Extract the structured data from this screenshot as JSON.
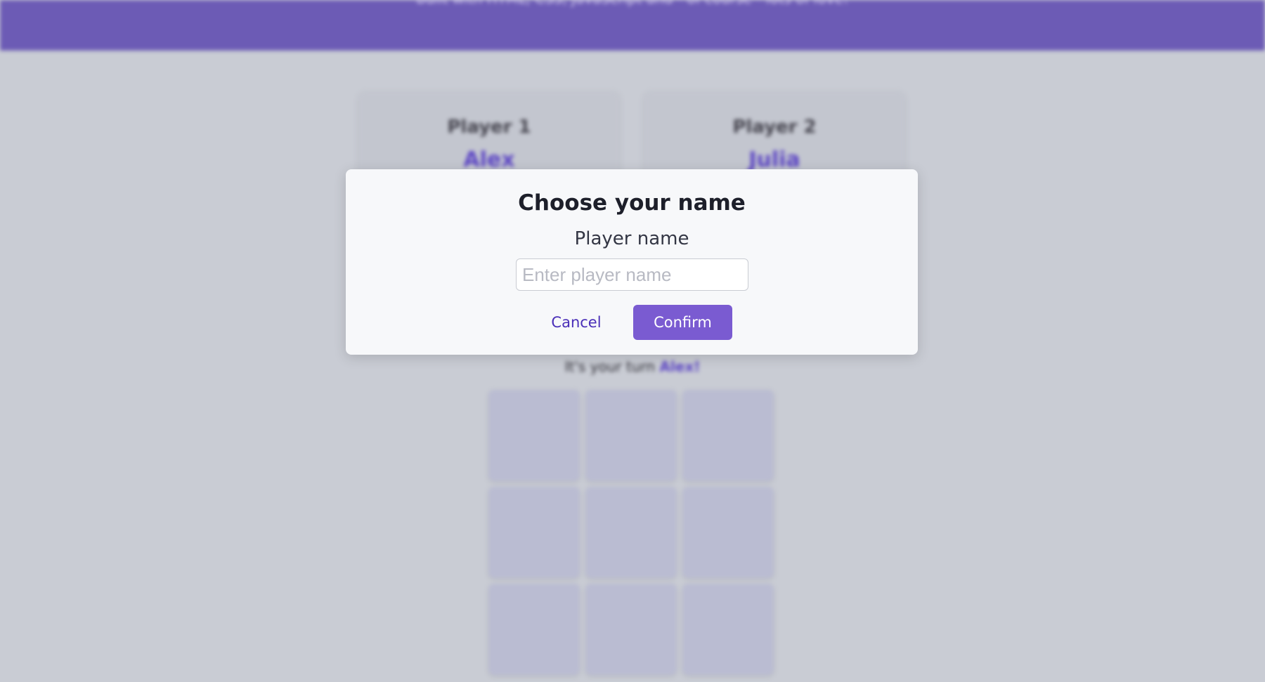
{
  "header": {
    "tagline": "Built with HTML, CSS, JavaScript and - of course - lots of love!"
  },
  "players": [
    {
      "title": "Player 1",
      "name": "Alex"
    },
    {
      "title": "Player 2",
      "name": "Julia"
    }
  ],
  "turn": {
    "prefix": "It's your turn ",
    "name": "Alex!"
  },
  "board": {
    "cells": [
      "",
      "",
      "",
      "",
      "",
      "",
      "",
      "",
      ""
    ]
  },
  "modal": {
    "title": "Choose your name",
    "label": "Player name",
    "input_value": "",
    "input_placeholder": "Enter player name",
    "cancel_label": "Cancel",
    "confirm_label": "Confirm"
  },
  "colors": {
    "accent": "#6c5bb5",
    "button": "#7a5bd1",
    "player_name": "#5b44c4",
    "cell": "#babcd2"
  }
}
